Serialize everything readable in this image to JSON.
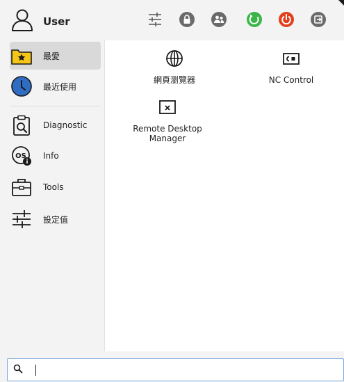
{
  "header": {
    "user_name": "User",
    "buttons": [
      {
        "icon": "sliders-icon",
        "color": "#555555"
      },
      {
        "icon": "lock-icon",
        "color": "#6a6a6a"
      },
      {
        "icon": "switch-user-icon",
        "color": "#6a6a6a"
      },
      {
        "icon": "restart-icon",
        "color": "#3bb54a"
      },
      {
        "icon": "power-icon",
        "color": "#e2401c"
      },
      {
        "icon": "logout-icon",
        "color": "#6a6a6a"
      }
    ]
  },
  "sidebar": {
    "items": [
      {
        "label": "最愛",
        "icon": "star-folder-icon",
        "active": true
      },
      {
        "label": "最近使用",
        "icon": "clock-icon",
        "active": false
      },
      {
        "label": "Diagnostic",
        "icon": "clipboard-search-icon",
        "active": false
      },
      {
        "label": "Info",
        "icon": "os-info-icon",
        "active": false
      },
      {
        "label": "Tools",
        "icon": "toolbox-icon",
        "active": false
      },
      {
        "label": "設定值",
        "icon": "settings-sliders-icon",
        "active": false
      }
    ]
  },
  "apps": [
    {
      "label": "網頁瀏覽器",
      "icon": "globe-icon"
    },
    {
      "label": "NC Control",
      "icon": "nc-control-icon"
    },
    {
      "label_line1": "Remote Desktop",
      "label_line2": "Manager",
      "icon": "remote-desktop-icon"
    }
  ],
  "search": {
    "value": "",
    "placeholder": ""
  },
  "colors": {
    "accent_blue": "#2f6dc2",
    "star_yellow": "#f5c518",
    "restart_green": "#3bb54a",
    "power_red": "#e2401c"
  }
}
